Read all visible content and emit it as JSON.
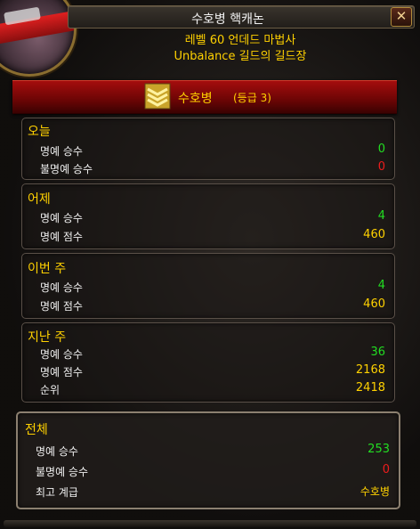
{
  "window": {
    "title": "수호병 핵캐논",
    "close_label": "✕",
    "subtitle_line1": "레벨 60 언데드 마법사",
    "subtitle_line2": "Unbalance 길드의 길드장"
  },
  "rank": {
    "name": "수호병",
    "grade": "(등급 3)",
    "icon": "rank-chevron-icon"
  },
  "today": {
    "title": "오늘",
    "rows": [
      {
        "label": "명예 승수",
        "value": "0"
      },
      {
        "label": "불명예 승수",
        "value": "0"
      }
    ]
  },
  "yesterday": {
    "title": "어제",
    "rows": [
      {
        "label": "명예 승수",
        "value": "4"
      },
      {
        "label": "명예 점수",
        "value": "460"
      }
    ]
  },
  "this_week": {
    "title": "이번 주",
    "rows": [
      {
        "label": "명예 승수",
        "value": "4"
      },
      {
        "label": "명예 점수",
        "value": "460"
      }
    ]
  },
  "last_week": {
    "title": "지난 주",
    "rows": [
      {
        "label": "명예 승수",
        "value": "36"
      },
      {
        "label": "명예 점수",
        "value": "2168"
      },
      {
        "label": "순위",
        "value": "2418"
      }
    ]
  },
  "lifetime": {
    "title": "전체",
    "rows": [
      {
        "label": "명예 승수",
        "value": "253"
      },
      {
        "label": "불명예 승수",
        "value": "0"
      },
      {
        "label": "최고 계급",
        "value": "수호병"
      }
    ]
  },
  "colors": {
    "gold": "#ffd100",
    "green": "#22dd22",
    "red": "#ee1c1c",
    "header_red": "#a40d0d"
  }
}
